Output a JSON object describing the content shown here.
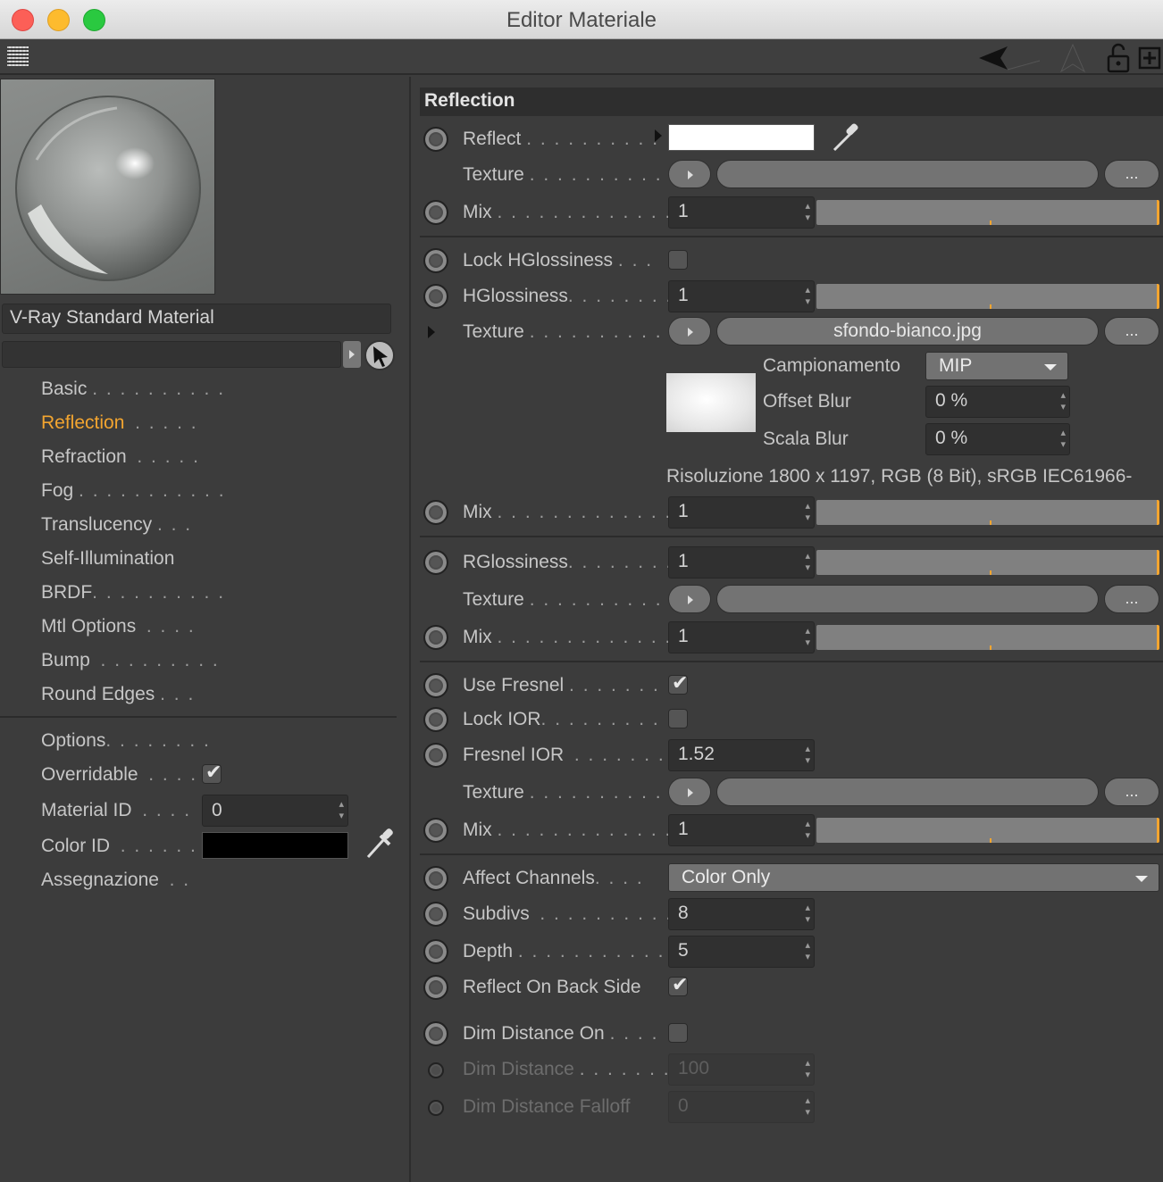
{
  "window": {
    "title": "Editor Materiale"
  },
  "material": {
    "name": "V-Ray Standard Material"
  },
  "nav": {
    "items": [
      {
        "label": "Basic",
        "dots": ". . . . . . . . . ."
      },
      {
        "label": "Reflection",
        "dots": ". . . . ."
      },
      {
        "label": "Refraction",
        "dots": ". . . . ."
      },
      {
        "label": "Fog",
        "dots": ". . . . . . . . . . ."
      },
      {
        "label": "Translucency",
        "dots": ". . ."
      },
      {
        "label": "Self-Illumination",
        "dots": ""
      },
      {
        "label": "BRDF",
        "dots": ". . . . . . . . . ."
      },
      {
        "label": "Mtl Options",
        "dots": ". . . ."
      },
      {
        "label": "Bump",
        "dots": ". . . . . . . . ."
      },
      {
        "label": "Round Edges",
        "dots": ". . ."
      }
    ],
    "active": "Reflection",
    "options": {
      "options_label": "Options",
      "options_dots": ". . . . . . . .",
      "overridable_label": "Overridable",
      "overridable_dots": ". . . .",
      "material_id_label": "Material ID",
      "material_id_dots": ". . . .",
      "material_id_value": "0",
      "color_id_label": "Color ID",
      "color_id_dots": ". . . . . . .",
      "assegnazione_label": "Assegnazione",
      "assegnazione_dots": ". ."
    }
  },
  "reflection": {
    "section_title": "Reflection",
    "reflect_label": "Reflect",
    "reflect_dots": ". . . . . . . . . .",
    "texture_label": "Texture",
    "texture_dots": ". . . . . . . . . . .",
    "mix_label": "Mix",
    "mix_dots": ". . . . . . . . . . . . . .",
    "more_label": "...",
    "mix1": "1",
    "lock_hgloss_label": "Lock HGlossiness",
    "lock_hgloss_dots": ". . .",
    "hgloss_label": "HGlossiness",
    "hgloss_dots": ". . . . . . . .",
    "hgloss_value": "1",
    "hgloss_texture": "sfondo-bianco.jpg",
    "campionamento_label": "Campionamento",
    "campionamento_value": "MIP",
    "offset_blur_label": "Offset Blur",
    "offset_blur_value": "0 %",
    "scala_blur_label": "Scala Blur",
    "scala_blur_value": "0 %",
    "risoluzione": "Risoluzione 1800 x 1197, RGB (8 Bit), sRGB IEC61966-",
    "mix2": "1",
    "rgloss_label": "RGlossiness",
    "rgloss_dots": ". . . . . . . .",
    "rgloss_value": "1",
    "mix3": "1",
    "use_fresnel_label": "Use Fresnel",
    "use_fresnel_dots": ". . . . . . . . .",
    "lock_ior_label": "Lock IOR",
    "lock_ior_dots": ". . . . . . . . . .",
    "fresnel_ior_label": "Fresnel IOR",
    "fresnel_ior_dots": ". . . . . . . . .",
    "fresnel_ior_value": "1.52",
    "mix4": "1",
    "affect_channels_label": "Affect Channels",
    "affect_channels_dots": ". . . .",
    "affect_channels_value": "Color Only",
    "subdivs_label": "Subdivs",
    "subdivs_dots": ". . . . . . . . . . .",
    "subdivs_value": "8",
    "depth_label": "Depth",
    "depth_dots": ". . . . . . . . . . . . .",
    "depth_value": "5",
    "reflect_back_label": "Reflect On Back Side",
    "dim_distance_on_label": "Dim Distance On",
    "dim_distance_on_dots": ". . . .",
    "dim_distance_label": "Dim Distance",
    "dim_distance_dots": ". . . . . . .",
    "dim_distance_value": "100",
    "dim_falloff_label": "Dim Distance Falloff",
    "dim_falloff_value": "0"
  },
  "colors": {
    "accent": "#f3a530",
    "panel": "#3c3c3c",
    "field": "#303030"
  }
}
